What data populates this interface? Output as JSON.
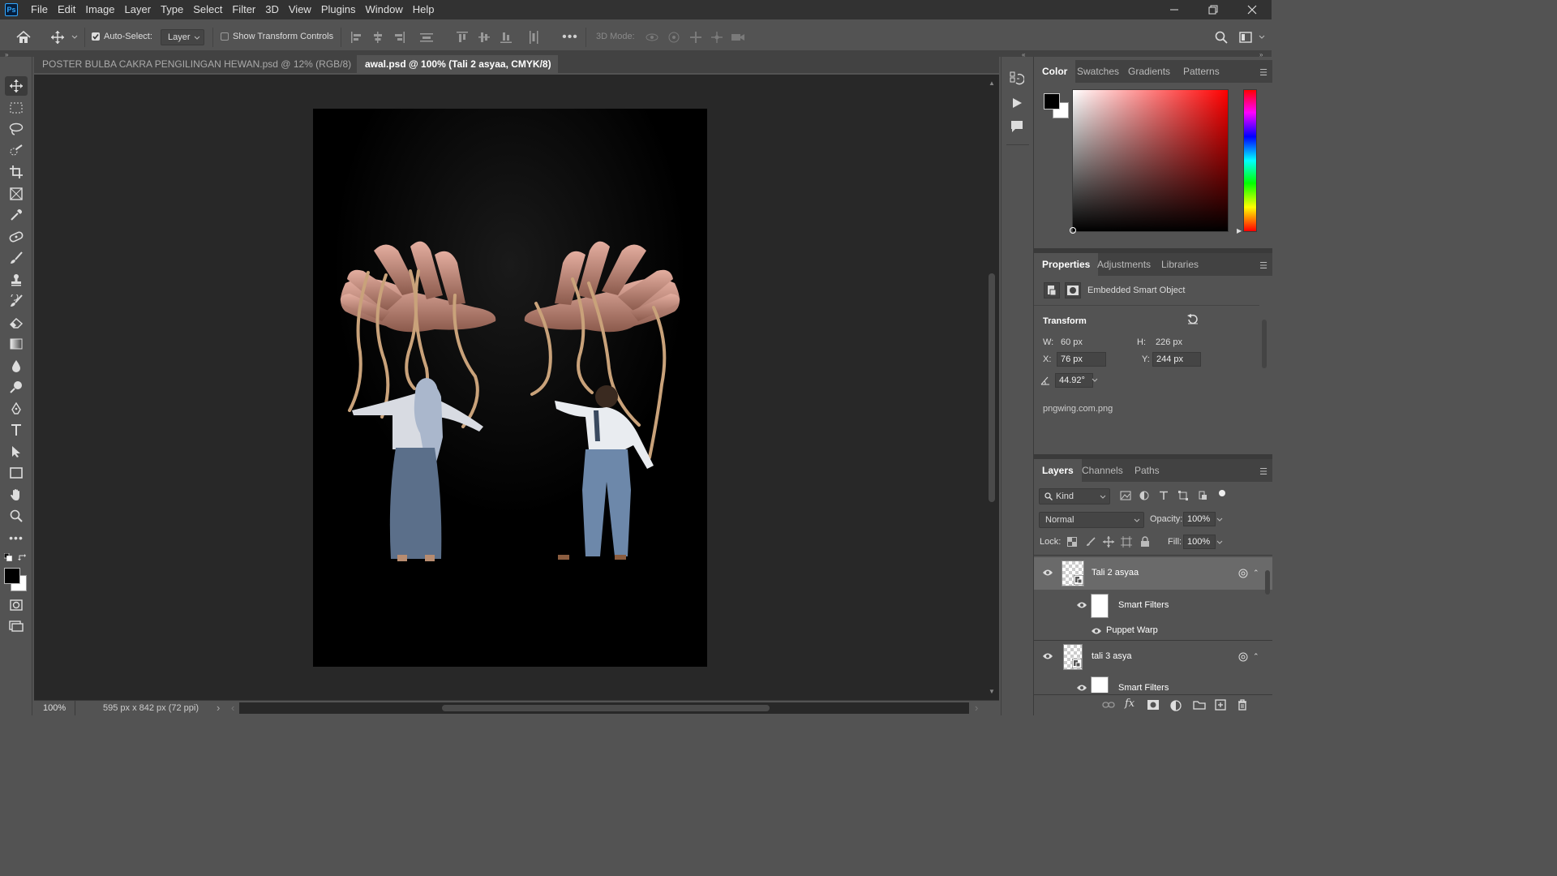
{
  "menubar": {
    "logo": "Ps",
    "items": [
      "File",
      "Edit",
      "Image",
      "Layer",
      "Type",
      "Select",
      "Filter",
      "3D",
      "View",
      "Plugins",
      "Window",
      "Help"
    ]
  },
  "options": {
    "auto_select_label": "Auto-Select:",
    "auto_select_checked": true,
    "layer_select": "Layer",
    "show_transform_label": "Show Transform Controls",
    "mode_3d_label": "3D Mode:"
  },
  "tabs": [
    {
      "label": "POSTER BULBA CAKRA PENGILINGAN HEWAN.psd @ 12% (RGB/8) *",
      "active": false
    },
    {
      "label": "awal.psd @ 100% (Tali 2 asyaa, CMYK/8)",
      "active": true
    }
  ],
  "status": {
    "zoom": "100%",
    "doc_info": "595 px x 842 px (72 ppi)"
  },
  "color_panel": {
    "tabs": [
      "Color",
      "Swatches",
      "Gradients",
      "Patterns"
    ],
    "foreground": "#000000",
    "background": "#ffffff",
    "hue_base": "#ff0000"
  },
  "properties": {
    "tabs": [
      "Properties",
      "Adjustments",
      "Libraries"
    ],
    "type_label": "Embedded Smart Object",
    "transform_label": "Transform",
    "w_label": "W:",
    "w_value": "60 px",
    "h_label": "H:",
    "h_value": "226 px",
    "x_label": "X:",
    "x_value": "76 px",
    "y_label": "Y:",
    "y_value": "244 px",
    "angle_value": "44.92°",
    "source_file": "pngwing.com.png"
  },
  "layers_panel": {
    "tabs": [
      "Layers",
      "Channels",
      "Paths"
    ],
    "filter_kind": "Kind",
    "blend_mode": "Normal",
    "opacity_label": "Opacity:",
    "opacity_value": "100%",
    "lock_label": "Lock:",
    "fill_label": "Fill:",
    "fill_value": "100%",
    "layers": [
      {
        "name": "Tali 2 asyaa",
        "selected": true
      },
      {
        "name": "Smart Filters",
        "sub": true
      },
      {
        "name": "Puppet Warp",
        "filter": true
      },
      {
        "name": "tali 3 asya",
        "selected": false
      },
      {
        "name": "Smart Filters",
        "sub": true
      }
    ]
  }
}
